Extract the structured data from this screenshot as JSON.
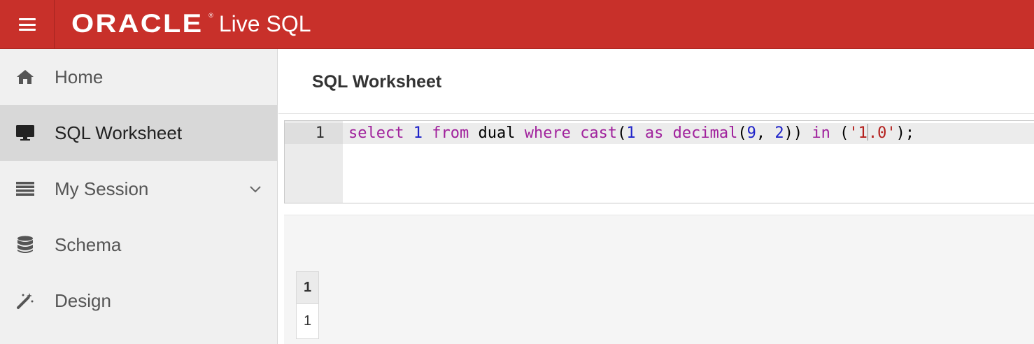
{
  "header": {
    "brand": "ORACLE",
    "registered": "®",
    "product": "Live SQL"
  },
  "sidebar": {
    "items": [
      {
        "label": "Home",
        "icon": "home-icon"
      },
      {
        "label": "SQL Worksheet",
        "icon": "monitor-icon",
        "active": true
      },
      {
        "label": "My Session",
        "icon": "list-icon",
        "expandable": true
      },
      {
        "label": "Schema",
        "icon": "database-icon"
      },
      {
        "label": "Design",
        "icon": "magic-wand-icon"
      }
    ]
  },
  "main": {
    "title": "SQL Worksheet",
    "editor": {
      "line_number": "1",
      "tokens": [
        {
          "t": "select",
          "c": "kw"
        },
        {
          "t": " ",
          "c": "pun"
        },
        {
          "t": "1",
          "c": "num"
        },
        {
          "t": " ",
          "c": "pun"
        },
        {
          "t": "from",
          "c": "kw"
        },
        {
          "t": " dual ",
          "c": "pun"
        },
        {
          "t": "where",
          "c": "kw"
        },
        {
          "t": " ",
          "c": "pun"
        },
        {
          "t": "cast",
          "c": "kw"
        },
        {
          "t": "(",
          "c": "pun"
        },
        {
          "t": "1",
          "c": "num"
        },
        {
          "t": " ",
          "c": "pun"
        },
        {
          "t": "as",
          "c": "kw"
        },
        {
          "t": " ",
          "c": "pun"
        },
        {
          "t": "decimal",
          "c": "kw"
        },
        {
          "t": "(",
          "c": "pun"
        },
        {
          "t": "9",
          "c": "num"
        },
        {
          "t": ", ",
          "c": "pun"
        },
        {
          "t": "2",
          "c": "num"
        },
        {
          "t": ")) ",
          "c": "pun"
        },
        {
          "t": "in",
          "c": "kw"
        },
        {
          "t": " (",
          "c": "pun"
        },
        {
          "t": "'1",
          "c": "str"
        },
        {
          "t": "|cursor|",
          "c": "cursor"
        },
        {
          "t": ".0'",
          "c": "str"
        },
        {
          "t": ");",
          "c": "pun"
        }
      ]
    },
    "results": {
      "columns": [
        "1"
      ],
      "rows": [
        [
          "1"
        ]
      ]
    }
  },
  "colors": {
    "header_bg": "#c8302a",
    "keyword": "#a0219c",
    "number": "#1f23c9",
    "string": "#b4201d"
  }
}
